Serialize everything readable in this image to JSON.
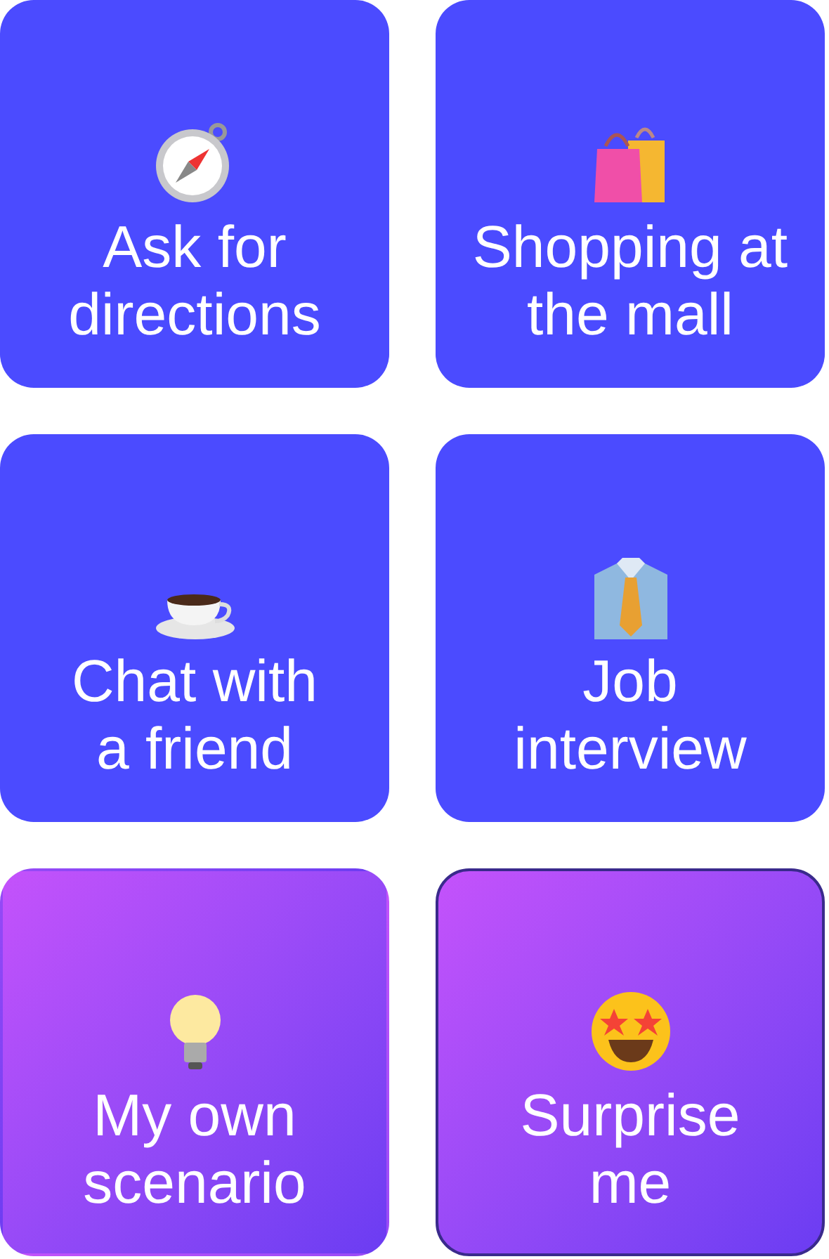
{
  "cards": [
    {
      "label": [
        "Ask for",
        "directions"
      ],
      "kind": "compass",
      "selected": false
    },
    {
      "label": [
        "Shopping at",
        "the mall"
      ],
      "kind": "bags",
      "selected": false
    },
    {
      "label": [
        "Chat with",
        "a friend"
      ],
      "kind": "coffee",
      "selected": false
    },
    {
      "label": [
        "Job",
        "interview"
      ],
      "kind": "shirt",
      "selected": false
    },
    {
      "label": [
        "My own",
        "scenario"
      ],
      "kind": "bulb",
      "selected": false
    },
    {
      "label": [
        "Surprise",
        "me"
      ],
      "kind": "starface",
      "selected": true
    }
  ]
}
